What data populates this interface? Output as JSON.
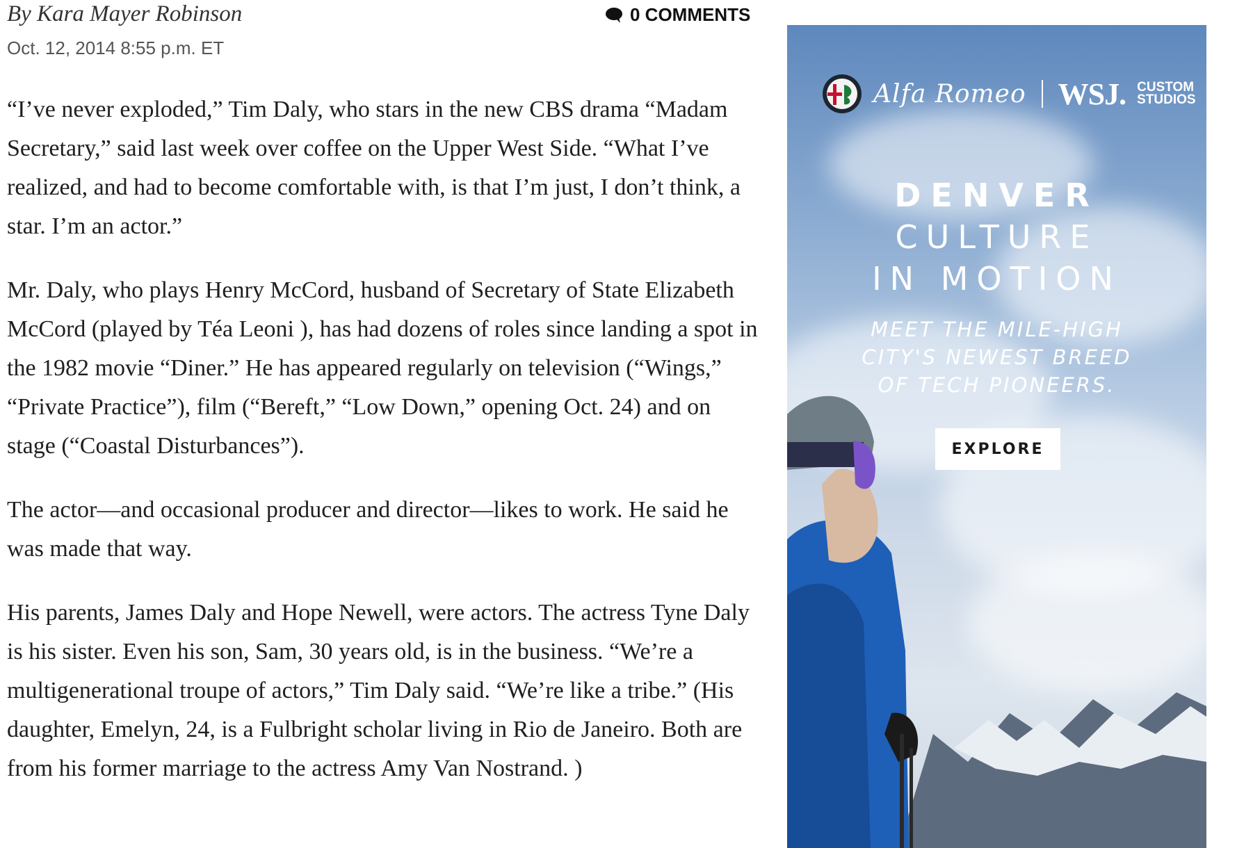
{
  "article": {
    "byline": "By Kara Mayer Robinson",
    "date": "Oct. 12, 2014 8:55 p.m. ET",
    "comments_label": "0 COMMENTS",
    "paragraphs": [
      "“I’ve never exploded,” Tim Daly, who stars in the new CBS drama “Madam Secretary,” said last week over coffee on the Upper West Side. “What I’ve realized, and had to become comfortable with, is that I’m just, I don’t think, a star. I’m an actor.”",
      "Mr. Daly, who plays Henry McCord, husband of Secretary of State Elizabeth McCord (played by Téa Leoni ), has had dozens of roles since landing a spot in the 1982 movie “Diner.” He has appeared regularly on television (“Wings,” “Private Practice”), film (“Bereft,” “Low Down,” opening Oct. 24) and on stage (“Coastal Disturbances”).",
      "The actor—and occasional producer and director—likes to work. He said he was made that way.",
      "His parents, James Daly and Hope Newell, were actors. The actress Tyne Daly is his sister. Even his son, Sam, 30 years old, is in the business. “We’re a multigenerational troupe of actors,” Tim Daly said. “We’re like a tribe.” (His daughter, Emelyn, 24, is a Fulbright scholar living in Rio de Janeiro. Both are from his former marriage to the actress Amy Van Nostrand. )"
    ]
  },
  "ad": {
    "brand_script": "Alfa Romeo",
    "wsj": "WSJ.",
    "custom_line1": "CUSTOM",
    "custom_line2": "STUDIOS",
    "headline1": "DENVER",
    "headline2": "CULTURE",
    "headline3": "IN MOTION",
    "sub1": "MEET THE MILE-HIGH",
    "sub2": "CITY'S NEWEST BREED",
    "sub3": "OF TECH PIONEERS.",
    "cta": "EXPLORE"
  },
  "colors": {
    "text": "#1f1f1f",
    "meta": "#555555",
    "sky_top": "#5e88bd",
    "jacket": "#1e5fb8",
    "helmet": "#6f7d86"
  },
  "icons": {
    "comments": "speech-bubble-icon",
    "alfa": "alfa-romeo-badge-icon"
  }
}
